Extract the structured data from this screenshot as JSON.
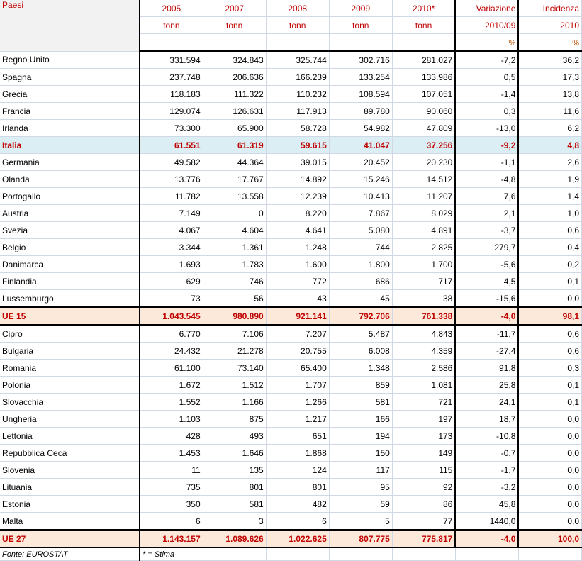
{
  "header": {
    "first_col": "Paesi",
    "years": [
      "2005",
      "2007",
      "2008",
      "2009",
      "2010*"
    ],
    "unit": "tonn",
    "variazione": {
      "label": "Variazione",
      "period": "2010/09",
      "unit": "%"
    },
    "incidenza": {
      "label": "Incidenza",
      "period": "2010",
      "unit": "%"
    }
  },
  "rows": [
    {
      "name": "Regno Unito",
      "v": [
        "331.594",
        "324.843",
        "325.744",
        "302.716",
        "281.027"
      ],
      "var": "-7,2",
      "inc": "36,2"
    },
    {
      "name": "Spagna",
      "v": [
        "237.748",
        "206.636",
        "166.239",
        "133.254",
        "133.986"
      ],
      "var": "0,5",
      "inc": "17,3"
    },
    {
      "name": "Grecia",
      "v": [
        "118.183",
        "111.322",
        "110.232",
        "108.594",
        "107.051"
      ],
      "var": "-1,4",
      "inc": "13,8"
    },
    {
      "name": "Francia",
      "v": [
        "129.074",
        "126.631",
        "117.913",
        "89.780",
        "90.060"
      ],
      "var": "0,3",
      "inc": "11,6"
    },
    {
      "name": "Irlanda",
      "v": [
        "73.300",
        "65.900",
        "58.728",
        "54.982",
        "47.809"
      ],
      "var": "-13,0",
      "inc": "6,2"
    },
    {
      "name": "Italia",
      "v": [
        "61.551",
        "61.319",
        "59.615",
        "41.047",
        "37.256"
      ],
      "var": "-9,2",
      "inc": "4,8",
      "type": "highlight"
    },
    {
      "name": "Germania",
      "v": [
        "49.582",
        "44.364",
        "39.015",
        "20.452",
        "20.230"
      ],
      "var": "-1,1",
      "inc": "2,6"
    },
    {
      "name": "Olanda",
      "v": [
        "13.776",
        "17.767",
        "14.892",
        "15.246",
        "14.512"
      ],
      "var": "-4,8",
      "inc": "1,9"
    },
    {
      "name": "Portogallo",
      "v": [
        "11.782",
        "13.558",
        "12.239",
        "10.413",
        "11.207"
      ],
      "var": "7,6",
      "inc": "1,4"
    },
    {
      "name": "Austria",
      "v": [
        "7.149",
        "0",
        "8.220",
        "7.867",
        "8.029"
      ],
      "var": "2,1",
      "inc": "1,0"
    },
    {
      "name": "Svezia",
      "v": [
        "4.067",
        "4.604",
        "4.641",
        "5.080",
        "4.891"
      ],
      "var": "-3,7",
      "inc": "0,6"
    },
    {
      "name": "Belgio",
      "v": [
        "3.344",
        "1.361",
        "1.248",
        "744",
        "2.825"
      ],
      "var": "279,7",
      "inc": "0,4"
    },
    {
      "name": "Danimarca",
      "v": [
        "1.693",
        "1.783",
        "1.600",
        "1.800",
        "1.700"
      ],
      "var": "-5,6",
      "inc": "0,2"
    },
    {
      "name": "Finlandia",
      "v": [
        "629",
        "746",
        "772",
        "686",
        "717"
      ],
      "var": "4,5",
      "inc": "0,1"
    },
    {
      "name": "Lussemburgo",
      "v": [
        "73",
        "56",
        "43",
        "45",
        "38"
      ],
      "var": "-15,6",
      "inc": "0,0"
    },
    {
      "name": "UE 15",
      "v": [
        "1.043.545",
        "980.890",
        "921.141",
        "792.706",
        "761.338"
      ],
      "var": "-4,0",
      "inc": "98,1",
      "type": "total"
    },
    {
      "name": "Cipro",
      "v": [
        "6.770",
        "7.106",
        "7.207",
        "5.487",
        "4.843"
      ],
      "var": "-11,7",
      "inc": "0,6"
    },
    {
      "name": "Bulgaria",
      "v": [
        "24.432",
        "21.278",
        "20.755",
        "6.008",
        "4.359"
      ],
      "var": "-27,4",
      "inc": "0,6"
    },
    {
      "name": "Romania",
      "v": [
        "61.100",
        "73.140",
        "65.400",
        "1.348",
        "2.586"
      ],
      "var": "91,8",
      "inc": "0,3"
    },
    {
      "name": "Polonia",
      "v": [
        "1.672",
        "1.512",
        "1.707",
        "859",
        "1.081"
      ],
      "var": "25,8",
      "inc": "0,1"
    },
    {
      "name": "Slovacchia",
      "v": [
        "1.552",
        "1.166",
        "1.266",
        "581",
        "721"
      ],
      "var": "24,1",
      "inc": "0,1"
    },
    {
      "name": "Ungheria",
      "v": [
        "1.103",
        "875",
        "1.217",
        "166",
        "197"
      ],
      "var": "18,7",
      "inc": "0,0"
    },
    {
      "name": "Lettonia",
      "v": [
        "428",
        "493",
        "651",
        "194",
        "173"
      ],
      "var": "-10,8",
      "inc": "0,0"
    },
    {
      "name": "Repubblica Ceca",
      "v": [
        "1.453",
        "1.646",
        "1.868",
        "150",
        "149"
      ],
      "var": "-0,7",
      "inc": "0,0"
    },
    {
      "name": "Slovenia",
      "v": [
        "11",
        "135",
        "124",
        "117",
        "115"
      ],
      "var": "-1,7",
      "inc": "0,0"
    },
    {
      "name": "Lituania",
      "v": [
        "735",
        "801",
        "801",
        "95",
        "92"
      ],
      "var": "-3,2",
      "inc": "0,0"
    },
    {
      "name": "Estonia",
      "v": [
        "350",
        "581",
        "482",
        "59",
        "86"
      ],
      "var": "45,8",
      "inc": "0,0"
    },
    {
      "name": "Malta",
      "v": [
        "6",
        "3",
        "6",
        "5",
        "77"
      ],
      "var": "1440,0",
      "inc": "0,0"
    },
    {
      "name": "UE 27",
      "v": [
        "1.143.157",
        "1.089.626",
        "1.022.625",
        "807.775",
        "775.817"
      ],
      "var": "-4,0",
      "inc": "100,0",
      "type": "total"
    }
  ],
  "footer": {
    "source": "Fonte: EUROSTAT",
    "note": "* = Stima"
  },
  "colors": {
    "header_text": "#c00000",
    "highlight_bg": "#daeef3",
    "total_bg": "#fde9d9",
    "grid": "#d0d7e5"
  }
}
